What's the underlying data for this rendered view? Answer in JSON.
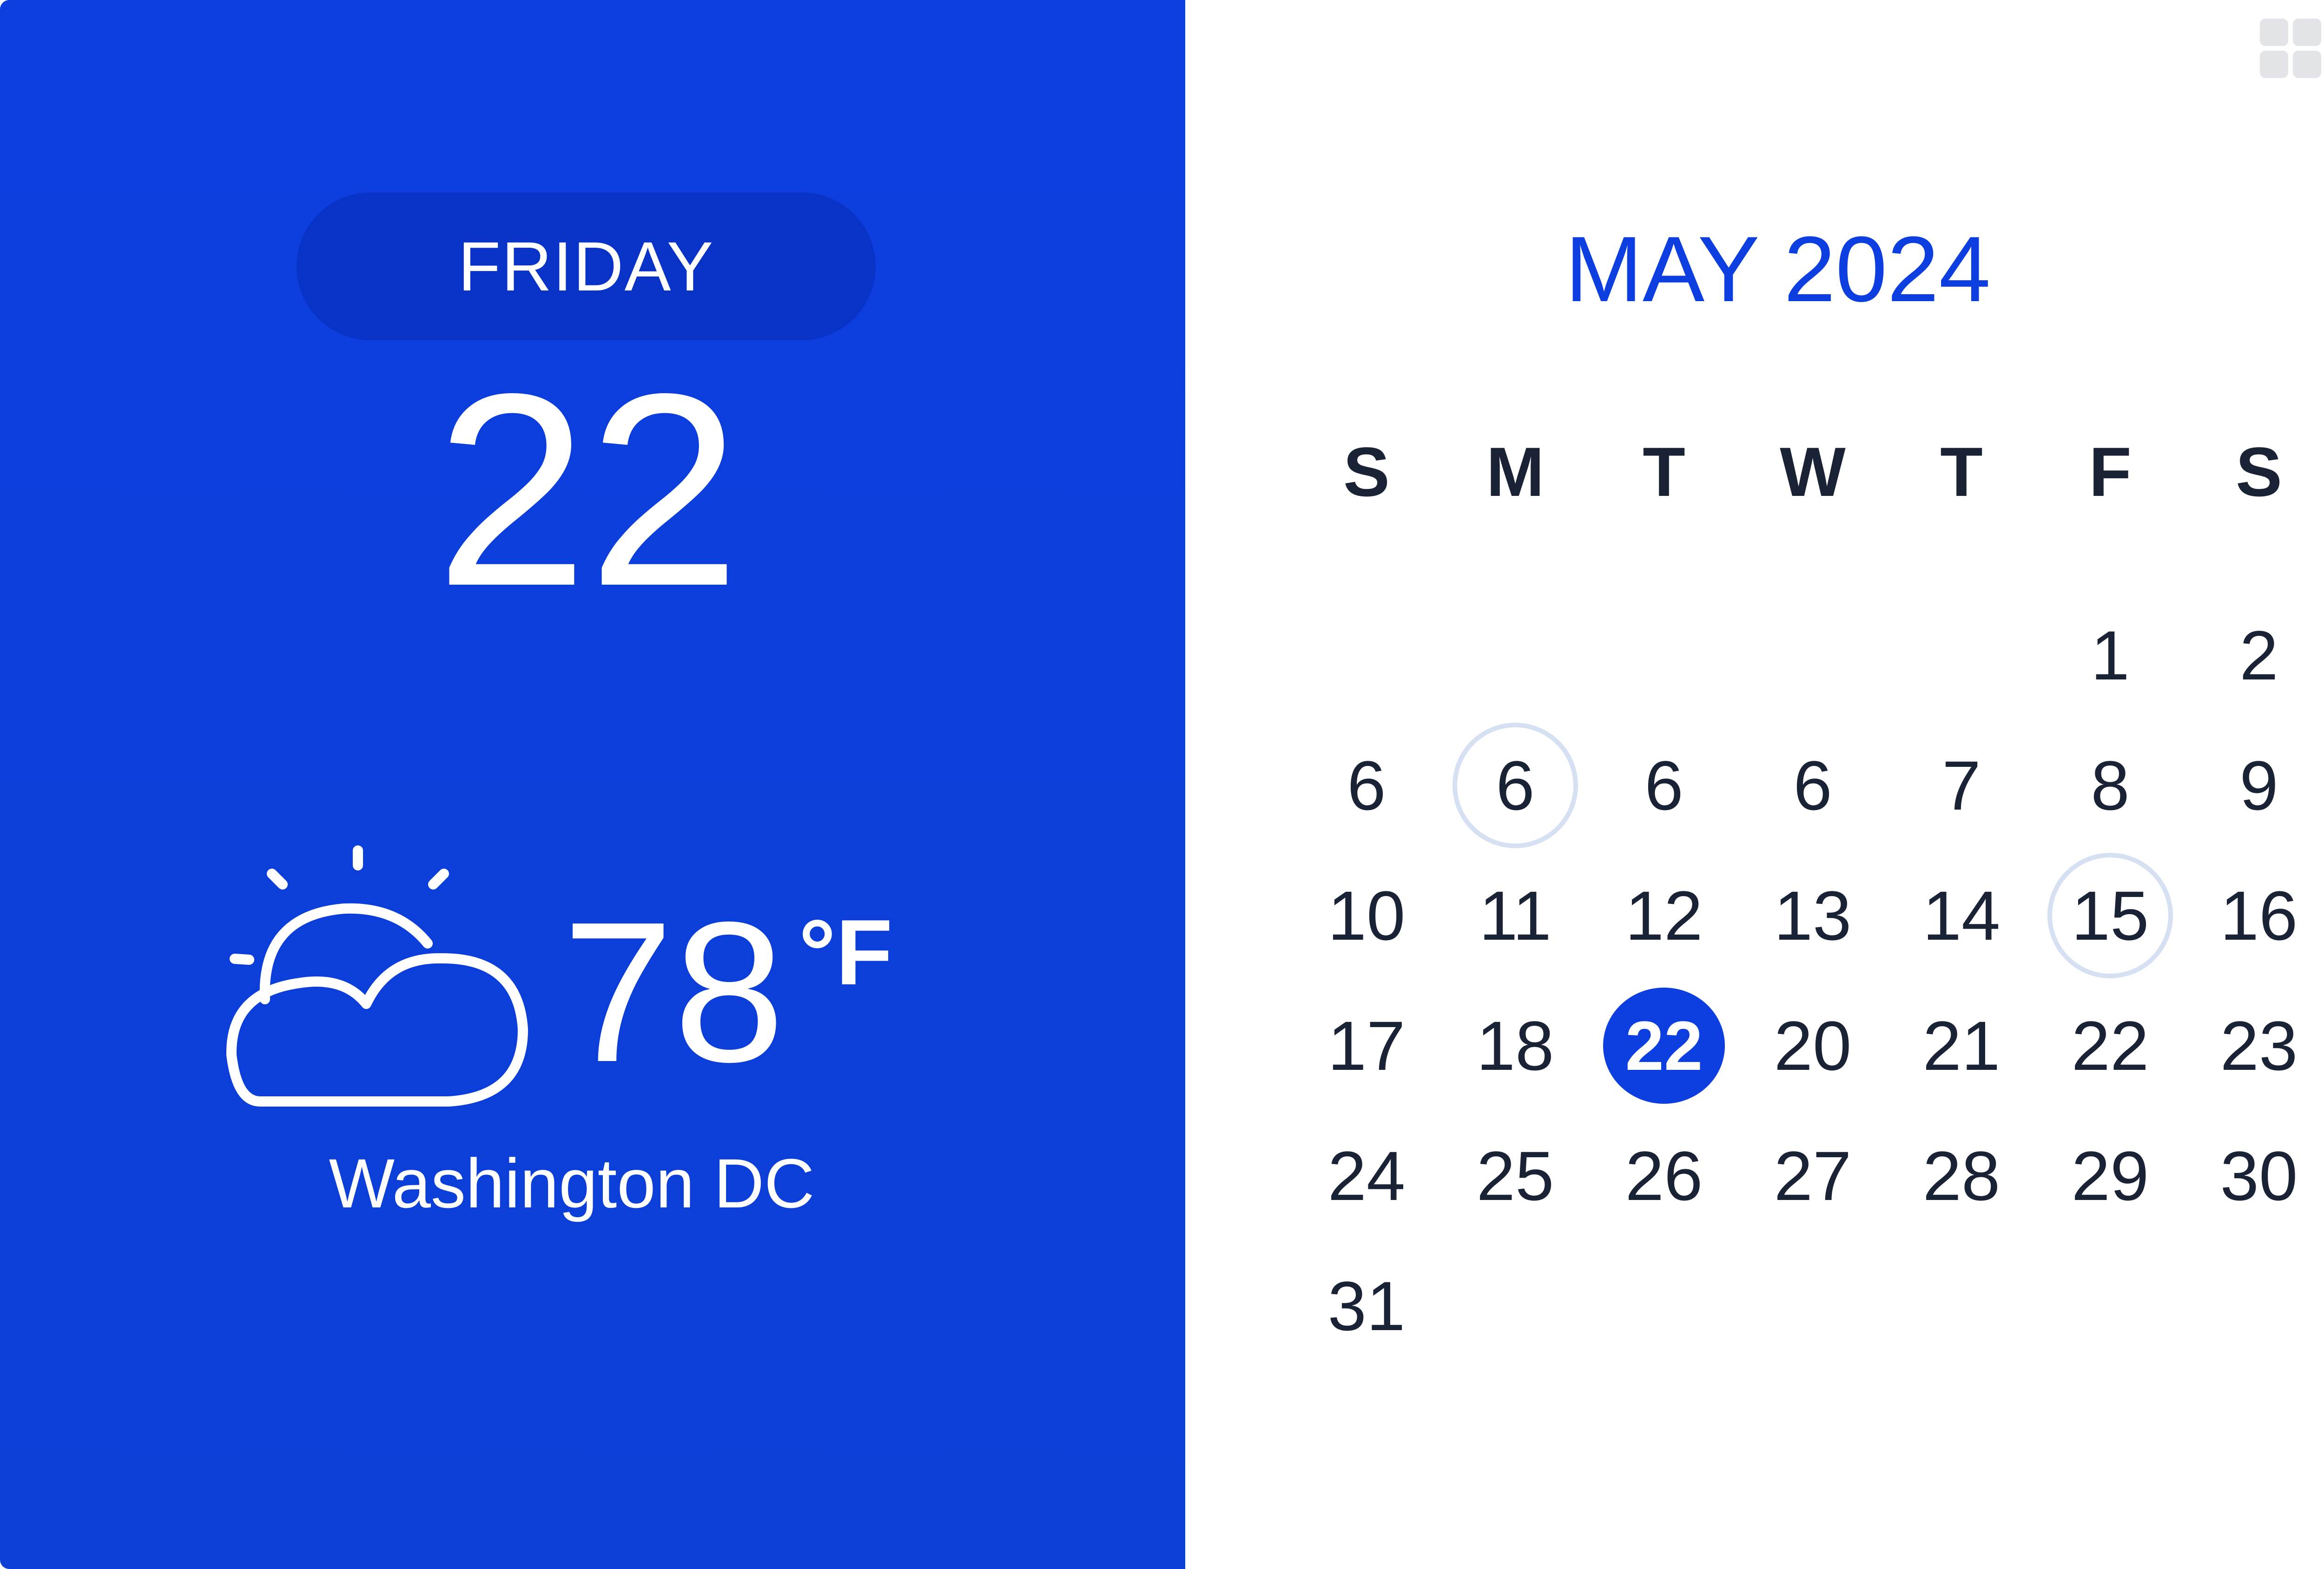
{
  "theme": {
    "accent": "#0d3ee0",
    "text": "#1a2236",
    "ring": "#d6e0f3"
  },
  "today": {
    "weekday": "FRIDAY",
    "date": "22"
  },
  "weather": {
    "icon": "partly-cloudy-icon",
    "temperature": "78",
    "unit": "°F",
    "location": "Washington DC"
  },
  "calendar": {
    "title": "MAY 2024",
    "weekdays": [
      "S",
      "M",
      "T",
      "W",
      "T",
      "F",
      "S"
    ],
    "weeks": [
      [
        "",
        "",
        "",
        "",
        "",
        "1",
        "2"
      ],
      [
        "6",
        "6",
        "6",
        "6",
        "7",
        "8",
        "9"
      ],
      [
        "10",
        "11",
        "12",
        "13",
        "14",
        "15",
        "16"
      ],
      [
        "17",
        "18",
        "22",
        "20",
        "21",
        "22",
        "23"
      ],
      [
        "24",
        "25",
        "26",
        "27",
        "28",
        "29",
        "30"
      ],
      [
        "31",
        "",
        "",
        "",
        "",
        "",
        ""
      ]
    ],
    "selected": {
      "week": 3,
      "day": 2
    },
    "ringed": [
      {
        "week": 1,
        "day": 1
      },
      {
        "week": 2,
        "day": 5
      }
    ]
  },
  "toolbar": {
    "grid_icon": "grid-icon"
  }
}
